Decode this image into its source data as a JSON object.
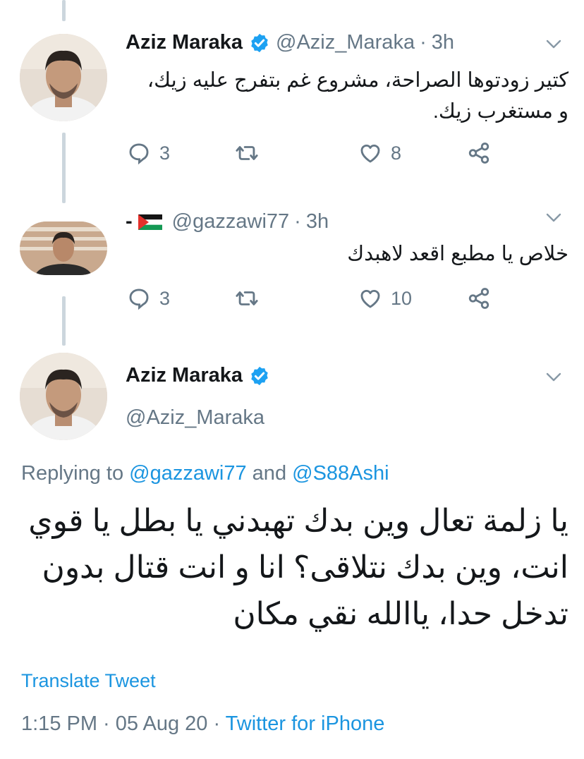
{
  "tweet1": {
    "name": "Aziz Maraka",
    "handle": "@Aziz_Maraka",
    "sep": "·",
    "time": "3h",
    "text_line1": "كتير زودتوها الصراحة، مشروع غم بتفرج عليه زيك،",
    "text_line2": "و مستغرب زيك.",
    "replies": "3",
    "likes": "8"
  },
  "tweet2": {
    "name_prefix": "-",
    "flag_icon": "palestine-flag-icon",
    "handle": "@gazzawi77",
    "sep": "·",
    "time": "3h",
    "text": "خلاص يا مطبع اقعد لاهبدك",
    "replies": "3",
    "likes": "10"
  },
  "main_tweet": {
    "name": "Aziz Maraka",
    "handle": "@Aziz_Maraka",
    "replying_prefix": "Replying to ",
    "mention1": "@gazzawi77",
    "and_word": " and ",
    "mention2": "@S88Ashi",
    "text": "يا زلمة تعال وين بدك تهبدني يا بطل يا قوي انت، وين بدك نتلاقى؟ انا و انت قتال بدون تدخل حدا، ياالله نقي مكان",
    "translate": "Translate Tweet",
    "time": "1:15 PM",
    "sep1": " · ",
    "date": "05 Aug 20",
    "sep2": " · ",
    "client": "Twitter for iPhone"
  },
  "colors": {
    "link": "#1b95e0",
    "muted": "#657786",
    "verified": "#1da1f2",
    "thread_line": "#ccd6dd"
  },
  "icons": [
    "reply-icon",
    "retweet-icon",
    "like-icon",
    "share-icon",
    "verified-badge-icon",
    "chevron-down-icon"
  ]
}
